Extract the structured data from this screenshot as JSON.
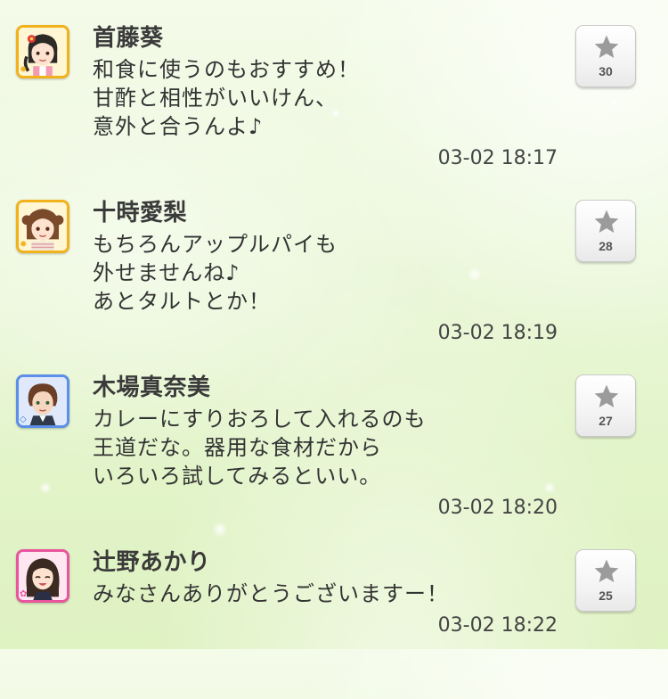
{
  "posts": [
    {
      "name": "首藤葵",
      "message": "和食に使うのもおすすめ！\n甘酢と相性がいいけん、\n意外と合うんよ♪",
      "timestamp": "03-02 18:17",
      "likes": "30",
      "avatar_frame": "gold"
    },
    {
      "name": "十時愛梨",
      "message": "もちろんアップルパイも\n外せませんね♪\nあとタルトとか！",
      "timestamp": "03-02 18:19",
      "likes": "28",
      "avatar_frame": "gold"
    },
    {
      "name": "木場真奈美",
      "message": "カレーにすりおろして入れるのも\n王道だな。器用な食材だから\nいろいろ試してみるといい。",
      "timestamp": "03-02 18:20",
      "likes": "27",
      "avatar_frame": "blue"
    },
    {
      "name": "辻野あかり",
      "message": "みなさんありがとうございますー！",
      "timestamp": "03-02 18:22",
      "likes": "25",
      "avatar_frame": "pink"
    }
  ],
  "icons": {
    "like": "star-icon",
    "badge_gold": "sun-icon",
    "badge_blue": "diamond-icon",
    "badge_pink": "flower-icon"
  },
  "colors": {
    "frame_gold": "#f2b21b",
    "frame_blue": "#5c8fe8",
    "frame_pink": "#e8559c",
    "star": "#9b9b9b"
  }
}
